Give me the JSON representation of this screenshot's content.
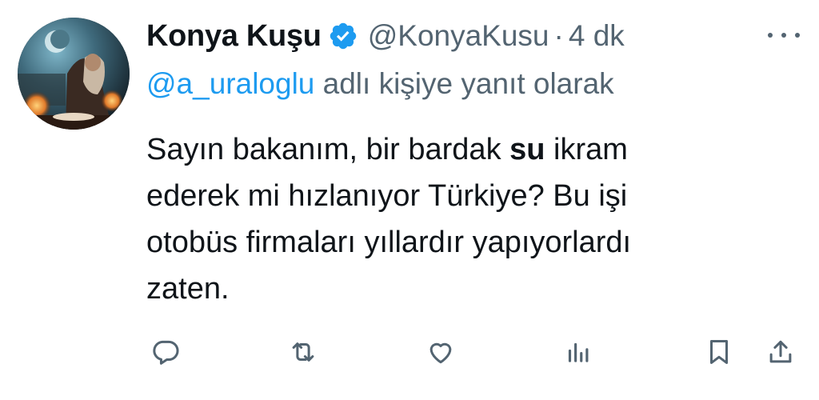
{
  "tweet": {
    "display_name": "Konya Kuşu",
    "handle": "@KonyaKusu",
    "separator": "·",
    "time": "4 dk",
    "reply_mention": "@a_uraloglu",
    "reply_suffix": " adlı kişiye yanıt olarak",
    "body": {
      "line1_before": "Sayın bakanım, bir bardak ",
      "line1_bold": "su",
      "line1_after": " ikram",
      "line2": "ederek mi hızlanıyor Türkiye? Bu işi",
      "line3": "otobüs firmaları yıllardır yapıyorlardı",
      "line4": "zaten."
    }
  },
  "icons": {
    "verified": "verified-badge-icon",
    "more": "more-options-icon",
    "reply": "reply-icon",
    "retweet": "retweet-icon",
    "like": "like-icon",
    "views": "views-icon",
    "bookmark": "bookmark-icon",
    "share": "share-icon"
  },
  "colors": {
    "text": "#0f1419",
    "secondary": "#536471",
    "accent": "#1d9bf0"
  }
}
